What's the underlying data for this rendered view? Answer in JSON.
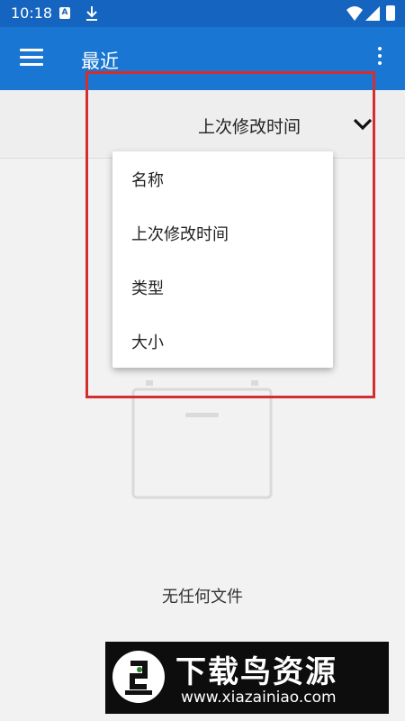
{
  "status_bar": {
    "time": "10:18",
    "notification_icons": [
      "A",
      "download-icon"
    ],
    "system_icons": [
      "wifi-icon",
      "cell-signal-icon",
      "battery-icon"
    ]
  },
  "toolbar": {
    "title": "最近",
    "menu_icon": "hamburger-menu-icon",
    "more_icon": "more-vert-icon",
    "color": "#1976d2"
  },
  "sort_bar": {
    "current_sort": "上次修改时间",
    "dropdown_icon": "chevron-down-icon"
  },
  "sort_menu": {
    "items": [
      {
        "label": "名称"
      },
      {
        "label": "上次修改时间"
      },
      {
        "label": "类型"
      },
      {
        "label": "大小"
      }
    ]
  },
  "empty_state": {
    "icon": "empty-folder-icon",
    "message": "无任何文件"
  },
  "annotation": {
    "highlight_color": "#d32f2f"
  },
  "watermark": {
    "brand": "下载鸟资源",
    "url": "www.xiazainiao.com"
  }
}
